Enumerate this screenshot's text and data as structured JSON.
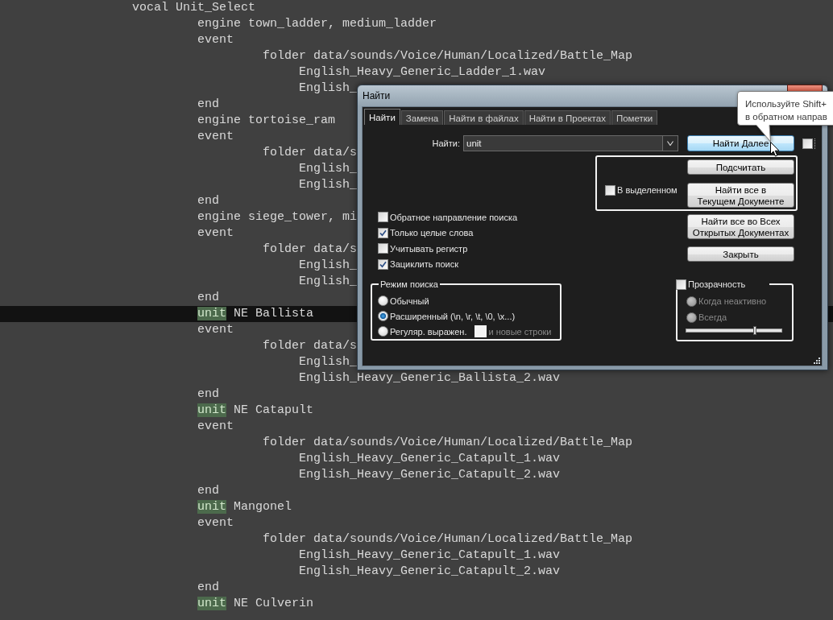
{
  "editor": {
    "lines": [
      {
        "text": "vocal Unit_Select",
        "current": false,
        "children": [
          {
            "text": "engine town_ladder, medium_ladder",
            "current": false
          },
          {
            "text": "event",
            "current": false,
            "children": [
              {
                "text": "folder data/sounds/Voice/Human/Localized/Battle_Map",
                "current": false,
                "children": [
                  {
                    "text": "English_Heavy_Generic_Ladder_1.wav",
                    "current": false
                  },
                  {
                    "text": "English_",
                    "current": false
                  }
                ]
              }
            ]
          },
          {
            "text": "end",
            "current": false
          },
          {
            "text": "engine tortoise_ram",
            "current": false
          },
          {
            "text": "event",
            "current": false,
            "children": [
              {
                "text": "folder data/s",
                "current": false,
                "children": [
                  {
                    "text": "English_",
                    "current": false
                  },
                  {
                    "text": "English_",
                    "current": false
                  }
                ]
              }
            ]
          },
          {
            "text": "end",
            "current": false
          },
          {
            "text": "engine siege_tower, mi",
            "current": false
          },
          {
            "text": "event",
            "current": false,
            "children": [
              {
                "text": "folder data/s",
                "current": false,
                "children": [
                  {
                    "text": "English_",
                    "current": false
                  },
                  {
                    "text": "English_",
                    "current": false
                  }
                ]
              }
            ]
          },
          {
            "text": "end",
            "current": false
          },
          {
            "match": "unit",
            "text": "NE Ballista",
            "current": true
          },
          {
            "text": "event",
            "current": false,
            "children": [
              {
                "text": "folder data/s",
                "current": false,
                "children": [
                  {
                    "text": "English_",
                    "current": false
                  },
                  {
                    "text": "English_Heavy_Generic_Ballista_2.wav",
                    "current": false
                  }
                ]
              }
            ]
          },
          {
            "text": "end",
            "current": false
          },
          {
            "match": "unit",
            "text": "NE Catapult",
            "current": false
          },
          {
            "text": "event",
            "current": false,
            "children": [
              {
                "text": "folder data/sounds/Voice/Human/Localized/Battle_Map",
                "current": false,
                "children": [
                  {
                    "text": "English_Heavy_Generic_Catapult_1.wav",
                    "current": false
                  },
                  {
                    "text": "English_Heavy_Generic_Catapult_2.wav",
                    "current": false
                  }
                ]
              }
            ]
          },
          {
            "text": "end",
            "current": false
          },
          {
            "match": "unit",
            "text": "Mangonel",
            "current": false
          },
          {
            "text": "event",
            "current": false,
            "children": [
              {
                "text": "folder data/sounds/Voice/Human/Localized/Battle_Map",
                "current": false,
                "children": [
                  {
                    "text": "English_Heavy_Generic_Catapult_1.wav",
                    "current": false
                  },
                  {
                    "text": "English_Heavy_Generic_Catapult_2.wav",
                    "current": false
                  }
                ]
              }
            ]
          },
          {
            "text": "end",
            "current": false
          },
          {
            "match": "unit",
            "text": "NE Culverin",
            "current": false
          }
        ]
      }
    ]
  },
  "find_dialog": {
    "title": "Найти",
    "tabs": [
      {
        "label": "Найти",
        "selected": true
      },
      {
        "label": "Замена",
        "selected": false
      },
      {
        "label": "Найти в файлах",
        "selected": false
      },
      {
        "label": "Найти в Проектах",
        "selected": false
      },
      {
        "label": "Пометки",
        "selected": false
      }
    ],
    "find_label": "Найти:",
    "find_field": {
      "value": "unit"
    },
    "find_next": {
      "label": "Найти Далее",
      "highlighted": true
    },
    "side_checkbox": {
      "checked": false
    },
    "selection_group": {
      "checkbox": {
        "label": "В выделенном",
        "checked": false
      },
      "buttons": [
        {
          "lines": [
            "Подсчитать"
          ]
        },
        {
          "lines": [
            "Найти все в",
            "Текущем Документе"
          ]
        }
      ]
    },
    "buttons": [
      {
        "lines": [
          "Найти все во Всех",
          "Открытых Документах"
        ]
      },
      {
        "lines": [
          "Закрыть"
        ]
      }
    ],
    "options": [
      {
        "label": "Обратное направление поиска",
        "checked": false
      },
      {
        "label": "Только целые слова",
        "checked": true
      },
      {
        "label": "Учитывать регистр",
        "checked": false
      },
      {
        "label": "Зациклить поиск",
        "checked": true
      }
    ],
    "search_mode": {
      "title": "Режим поиска",
      "options": [
        {
          "label": "Обычный",
          "selected": false,
          "disabled": false
        },
        {
          "label": "Расширенный (\\n, \\r, \\t, \\0, \\x...)",
          "selected": true,
          "disabled": false
        },
        {
          "label": "Регуляр. выражен.",
          "selected": false,
          "disabled": false,
          "extra": {
            "label": "и новые строки",
            "checked": false,
            "disabled": true
          }
        }
      ]
    },
    "transparency": {
      "label": "Прозрачность",
      "checked": false,
      "options": [
        {
          "label": "Когда неактивно",
          "selected": false,
          "disabled": true
        },
        {
          "label": "Всегда",
          "selected": false,
          "disabled": true
        }
      ],
      "slider": {
        "level": 0.72
      }
    }
  },
  "tooltip": {
    "lines": [
      "Используйте Shift+",
      "в обратном направ"
    ]
  }
}
